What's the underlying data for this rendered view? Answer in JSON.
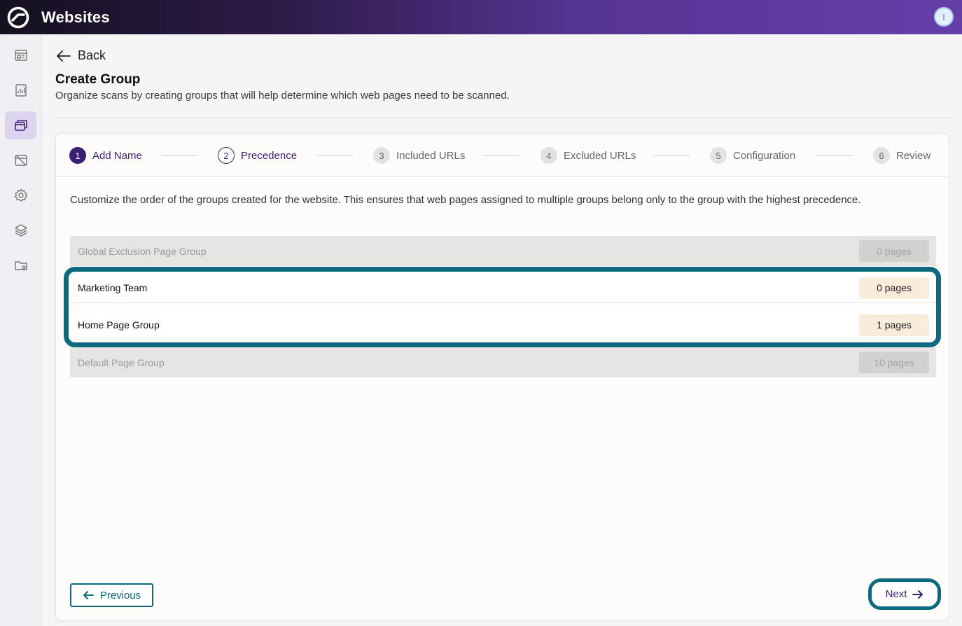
{
  "app": {
    "title": "Websites",
    "avatar_initial": "I"
  },
  "sidebar": {
    "items": [
      {
        "icon": "dashboard-icon",
        "active": false
      },
      {
        "icon": "report-icon",
        "active": false
      },
      {
        "icon": "page-groups-icon",
        "active": true
      },
      {
        "icon": "browser-off-icon",
        "active": false
      },
      {
        "icon": "settings-gear-icon",
        "active": false
      },
      {
        "icon": "layers-icon",
        "active": false
      },
      {
        "icon": "folder-settings-icon",
        "active": false
      }
    ]
  },
  "header": {
    "back_label": "Back",
    "title": "Create Group",
    "subtitle": "Organize scans by creating groups that will help determine which web pages need to be scanned."
  },
  "stepper": {
    "steps": [
      {
        "num": "1",
        "label": "Add Name",
        "state": "done"
      },
      {
        "num": "2",
        "label": "Precedence",
        "state": "current"
      },
      {
        "num": "3",
        "label": "Included URLs",
        "state": "pending"
      },
      {
        "num": "4",
        "label": "Excluded URLs",
        "state": "pending"
      },
      {
        "num": "5",
        "label": "Configuration",
        "state": "pending"
      },
      {
        "num": "6",
        "label": "Review",
        "state": "pending"
      }
    ]
  },
  "content": {
    "description": "Customize the order of the groups created for the website. This ensures that web pages assigned to multiple groups belong only to the group with the highest precedence."
  },
  "groups": [
    {
      "name": "Global Exclusion Page Group",
      "pages": "0 pages",
      "enabled": false
    },
    {
      "name": "Marketing Team",
      "pages": "0 pages",
      "enabled": true
    },
    {
      "name": "Home Page Group",
      "pages": "1 pages",
      "enabled": true
    },
    {
      "name": "Default Page Group",
      "pages": "10 pages",
      "enabled": false
    }
  ],
  "footer": {
    "previous_label": "Previous",
    "next_label": "Next"
  },
  "colors": {
    "accent_teal": "#0d6a7e",
    "brand_purple": "#3b1f71",
    "badge_peach": "#faecdb"
  }
}
